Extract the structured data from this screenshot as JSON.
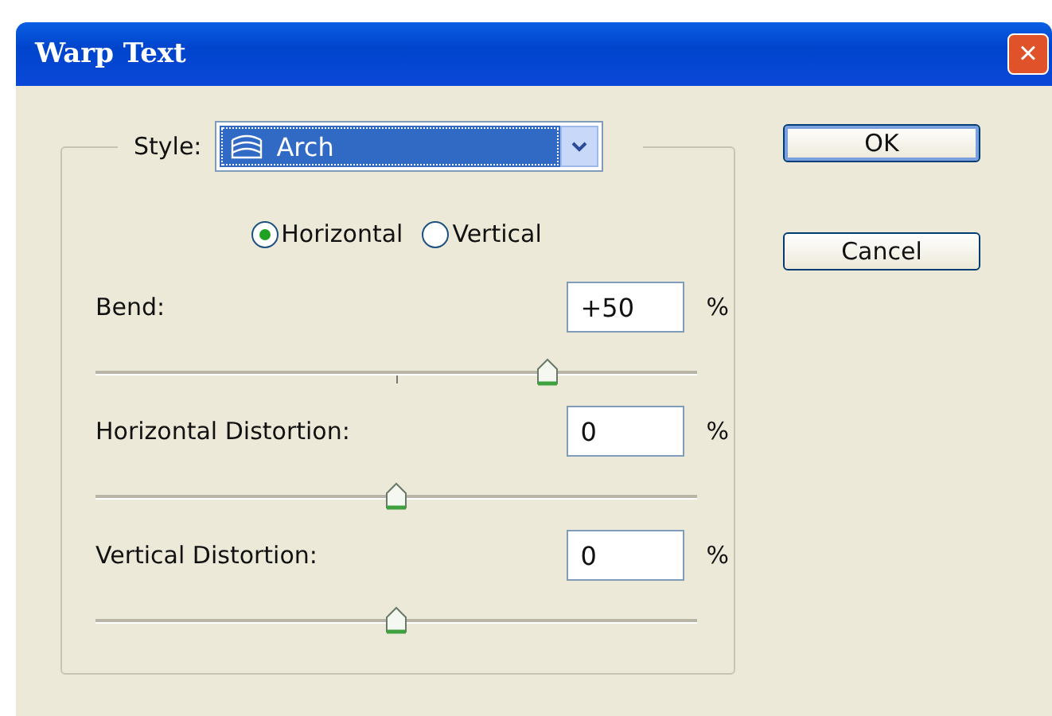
{
  "window": {
    "title": "Warp Text",
    "close": "×"
  },
  "style": {
    "label": "Style:",
    "value": "Arch"
  },
  "orientation": [
    {
      "label": "Horizontal",
      "selected": true
    },
    {
      "label": "Vertical",
      "selected": false
    }
  ],
  "sliders": [
    {
      "label": "Bend:",
      "value": "+50",
      "unit": "%",
      "level": 0.75
    },
    {
      "label": "Horizontal Distortion:",
      "value": "0",
      "unit": "%",
      "level": 0.5
    },
    {
      "label": "Vertical Distortion:",
      "value": "0",
      "unit": "%",
      "level": 0.5
    }
  ],
  "buttons": [
    {
      "label": "OK",
      "default": true
    },
    {
      "label": "Cancel",
      "default": false
    }
  ]
}
